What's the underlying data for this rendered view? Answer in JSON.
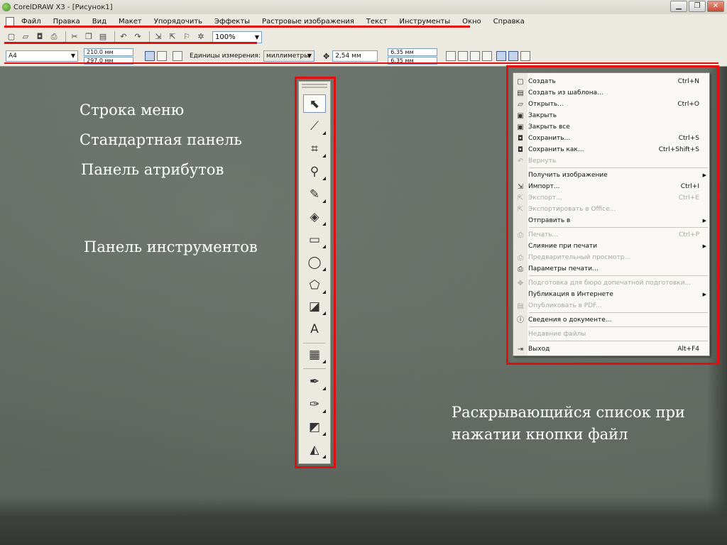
{
  "window": {
    "title": "CorelDRAW X3 - [Рисунок1]",
    "controls": [
      "▁",
      "❐",
      "✕"
    ]
  },
  "menu_bar": {
    "items": [
      "Файл",
      "Правка",
      "Вид",
      "Макет",
      "Упорядочить",
      "Эффекты",
      "Растровые изображения",
      "Текст",
      "Инструменты",
      "Окно",
      "Справка"
    ]
  },
  "standard_toolbar": {
    "zoom_value": "100%"
  },
  "property_bar": {
    "paper_size": "A4",
    "width": "210.0 мм",
    "height": "297.0 мм",
    "units_label": "Единицы измерения:",
    "units_value": "миллиметры",
    "nudge": "2,54 мм",
    "dup_x": "6.35 мм",
    "dup_y": "6.35 мм"
  },
  "captions": {
    "menu_bar": "Строка меню",
    "standard_bar": "Стандартная панель",
    "attributes_bar": "Панель атрибутов",
    "toolbox": "Панель инструментов",
    "dropdown_line1": "Раскрывающийся список  при",
    "dropdown_line2": "нажатии кнопки файл"
  },
  "toolbox": {
    "tools": [
      {
        "name": "pick-tool",
        "glyph": "⬉",
        "active": true,
        "flyout": false
      },
      {
        "name": "shape-tool",
        "glyph": "⟋",
        "active": false,
        "flyout": true
      },
      {
        "name": "crop-tool",
        "glyph": "⌗",
        "active": false,
        "flyout": true
      },
      {
        "name": "zoom-tool",
        "glyph": "⚲",
        "active": false,
        "flyout": true
      },
      {
        "name": "freehand-tool",
        "glyph": "✎",
        "active": false,
        "flyout": true
      },
      {
        "name": "smart-fill-tool",
        "glyph": "◈",
        "active": false,
        "flyout": true
      },
      {
        "name": "rectangle-tool",
        "glyph": "▭",
        "active": false,
        "flyout": true
      },
      {
        "name": "ellipse-tool",
        "glyph": "◯",
        "active": false,
        "flyout": true
      },
      {
        "name": "polygon-tool",
        "glyph": "⬠",
        "active": false,
        "flyout": true
      },
      {
        "name": "basic-shapes-tool",
        "glyph": "◪",
        "active": false,
        "flyout": true
      },
      {
        "name": "text-tool",
        "glyph": "A",
        "active": false,
        "flyout": false
      },
      {
        "name": "interactive-blend-tool",
        "glyph": "▦",
        "active": false,
        "flyout": true
      },
      {
        "name": "eyedropper-tool",
        "glyph": "✒",
        "active": false,
        "flyout": true
      },
      {
        "name": "outline-tool",
        "glyph": "✑",
        "active": false,
        "flyout": true
      },
      {
        "name": "fill-tool",
        "glyph": "◩",
        "active": false,
        "flyout": true
      },
      {
        "name": "interactive-fill-tool",
        "glyph": "◭",
        "active": false,
        "flyout": true
      }
    ]
  },
  "file_menu": {
    "items": [
      {
        "label": "Создать",
        "shortcut": "Ctrl+N",
        "icon": "new-icon",
        "glyph": "▢",
        "disabled": false,
        "submenu": false
      },
      {
        "label": "Создать из шаблона...",
        "shortcut": "",
        "icon": "template-icon",
        "glyph": "▤",
        "disabled": false,
        "submenu": false
      },
      {
        "label": "Открыть...",
        "shortcut": "Ctrl+O",
        "icon": "open-icon",
        "glyph": "▱",
        "disabled": false,
        "submenu": false
      },
      {
        "label": "Закрыть",
        "shortcut": "",
        "icon": "close-doc-icon",
        "glyph": "▣",
        "disabled": false,
        "submenu": false
      },
      {
        "label": "Закрыть все",
        "shortcut": "",
        "icon": "close-all-icon",
        "glyph": "▣",
        "disabled": false,
        "submenu": false
      },
      {
        "label": "Сохранить...",
        "shortcut": "Ctrl+S",
        "icon": "save-icon",
        "glyph": "◘",
        "disabled": false,
        "submenu": false
      },
      {
        "label": "Сохранить как...",
        "shortcut": "Ctrl+Shift+S",
        "icon": "save-as-icon",
        "glyph": "◘",
        "disabled": false,
        "submenu": false
      },
      {
        "label": "Вернуть",
        "shortcut": "",
        "icon": "revert-icon",
        "glyph": "↶",
        "disabled": true,
        "submenu": false
      },
      {
        "label": "Получить изображение",
        "shortcut": "",
        "icon": "",
        "glyph": "",
        "disabled": false,
        "submenu": true
      },
      {
        "label": "Импорт...",
        "shortcut": "Ctrl+I",
        "icon": "import-icon",
        "glyph": "⇲",
        "disabled": false,
        "submenu": false
      },
      {
        "label": "Экспорт...",
        "shortcut": "Ctrl+E",
        "icon": "export-icon",
        "glyph": "⇱",
        "disabled": true,
        "submenu": false
      },
      {
        "label": "Экспортировать в Office...",
        "shortcut": "",
        "icon": "export-office-icon",
        "glyph": "⇱",
        "disabled": true,
        "submenu": false
      },
      {
        "label": "Отправить в",
        "shortcut": "",
        "icon": "",
        "glyph": "",
        "disabled": false,
        "submenu": true
      },
      {
        "label": "Печать...",
        "shortcut": "Ctrl+P",
        "icon": "print-icon",
        "glyph": "⎙",
        "disabled": true,
        "submenu": false
      },
      {
        "label": "Слияние при печати",
        "shortcut": "",
        "icon": "",
        "glyph": "",
        "disabled": false,
        "submenu": true
      },
      {
        "label": "Предварительный просмотр...",
        "shortcut": "",
        "icon": "print-preview-icon",
        "glyph": "⎙",
        "disabled": true,
        "submenu": false
      },
      {
        "label": "Параметры печати...",
        "shortcut": "",
        "icon": "print-setup-icon",
        "glyph": "⎙",
        "disabled": false,
        "submenu": false
      },
      {
        "label": "Подготовка для бюро допечатной подготовки...",
        "shortcut": "",
        "icon": "prepress-icon",
        "glyph": "✥",
        "disabled": true,
        "submenu": false
      },
      {
        "label": "Публикация в Интернете",
        "shortcut": "",
        "icon": "",
        "glyph": "",
        "disabled": false,
        "submenu": true
      },
      {
        "label": "Опубликовать в PDF...",
        "shortcut": "",
        "icon": "pdf-icon",
        "glyph": "▤",
        "disabled": true,
        "submenu": false
      },
      {
        "label": "Сведения о документе...",
        "shortcut": "",
        "icon": "doc-info-icon",
        "glyph": "ⓘ",
        "disabled": false,
        "submenu": false
      },
      {
        "label": "Недавние файлы",
        "shortcut": "",
        "icon": "",
        "glyph": "",
        "disabled": true,
        "submenu": false
      },
      {
        "label": "Выход",
        "shortcut": "Alt+F4",
        "icon": "exit-icon",
        "glyph": "⇥",
        "disabled": false,
        "submenu": false
      }
    ]
  },
  "colors": {
    "highlight": "#e01010",
    "caption": "#ffffff",
    "slide": "#626962"
  }
}
